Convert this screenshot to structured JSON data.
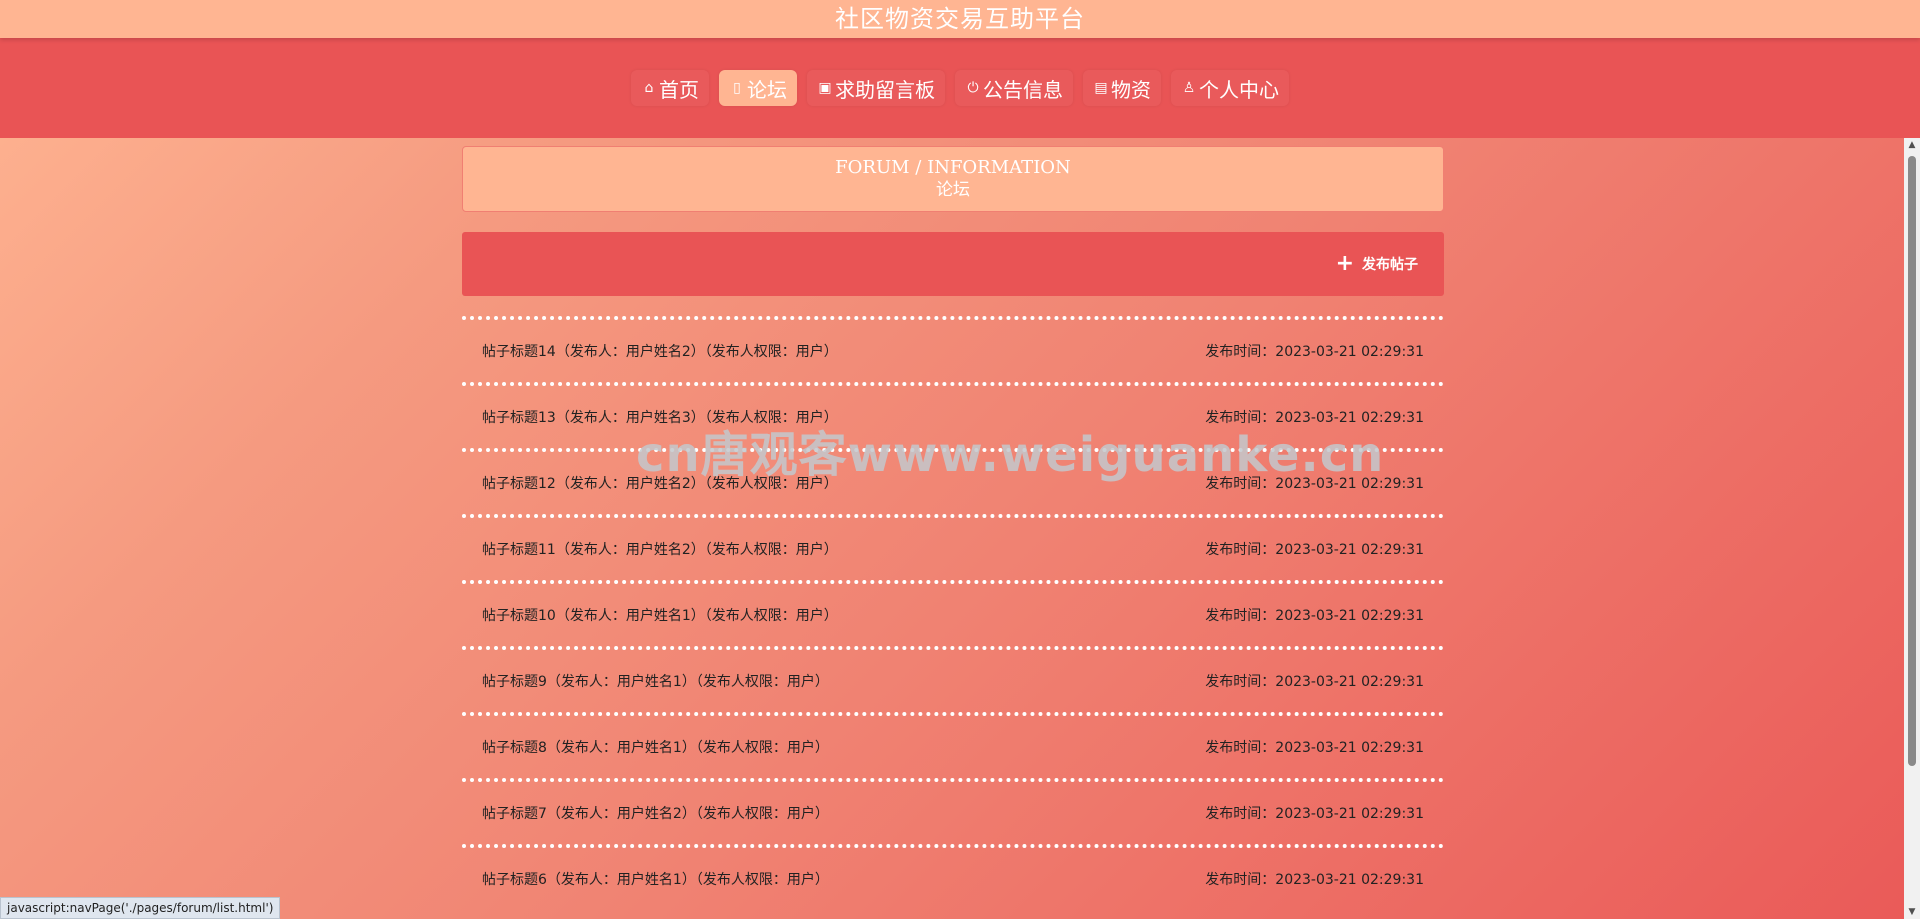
{
  "site": {
    "title": "社区物资交易互助平台"
  },
  "nav": {
    "items": [
      {
        "label": "首页",
        "icon": "home-icon",
        "glyph": "⌂"
      },
      {
        "label": "论坛",
        "icon": "forum-icon",
        "glyph": "▯",
        "active": true
      },
      {
        "label": "求助留言板",
        "icon": "message-board-icon",
        "glyph": "▣"
      },
      {
        "label": "公告信息",
        "icon": "power-icon",
        "glyph": "⏻"
      },
      {
        "label": "物资",
        "icon": "goods-icon",
        "glyph": "▤"
      },
      {
        "label": "个人中心",
        "icon": "user-icon",
        "glyph": "♙"
      }
    ]
  },
  "section": {
    "title_en": "FORUM / INFORMATION",
    "title_zh": "论坛"
  },
  "actions": {
    "post_label": "发布帖子"
  },
  "posts": [
    {
      "title": "帖子标题14（发布人：用户姓名2）（发布人权限：用户）",
      "time": "发布时间：2023-03-21 02:29:31"
    },
    {
      "title": "帖子标题13（发布人：用户姓名3）（发布人权限：用户）",
      "time": "发布时间：2023-03-21 02:29:31"
    },
    {
      "title": "帖子标题12（发布人：用户姓名2）（发布人权限：用户）",
      "time": "发布时间：2023-03-21 02:29:31"
    },
    {
      "title": "帖子标题11（发布人：用户姓名2）（发布人权限：用户）",
      "time": "发布时间：2023-03-21 02:29:31"
    },
    {
      "title": "帖子标题10（发布人：用户姓名1）（发布人权限：用户）",
      "time": "发布时间：2023-03-21 02:29:31"
    },
    {
      "title": "帖子标题9（发布人：用户姓名1）（发布人权限：用户）",
      "time": "发布时间：2023-03-21 02:29:31"
    },
    {
      "title": "帖子标题8（发布人：用户姓名1）（发布人权限：用户）",
      "time": "发布时间：2023-03-21 02:29:31"
    },
    {
      "title": "帖子标题7（发布人：用户姓名2）（发布人权限：用户）",
      "time": "发布时间：2023-03-21 02:29:31"
    },
    {
      "title": "帖子标题6（发布人：用户姓名1）（发布人权限：用户）",
      "time": "发布时间：2023-03-21 02:29:31"
    }
  ],
  "watermark": "cn唐观客www.weiguanke.cn",
  "statusbar": {
    "text": "javascript:navPage('./pages/forum/list.html')"
  },
  "colors": {
    "topbar": "#ffb592",
    "navband": "#e95455",
    "active_tab": "#ffb592",
    "action_bar": "#e95455"
  }
}
